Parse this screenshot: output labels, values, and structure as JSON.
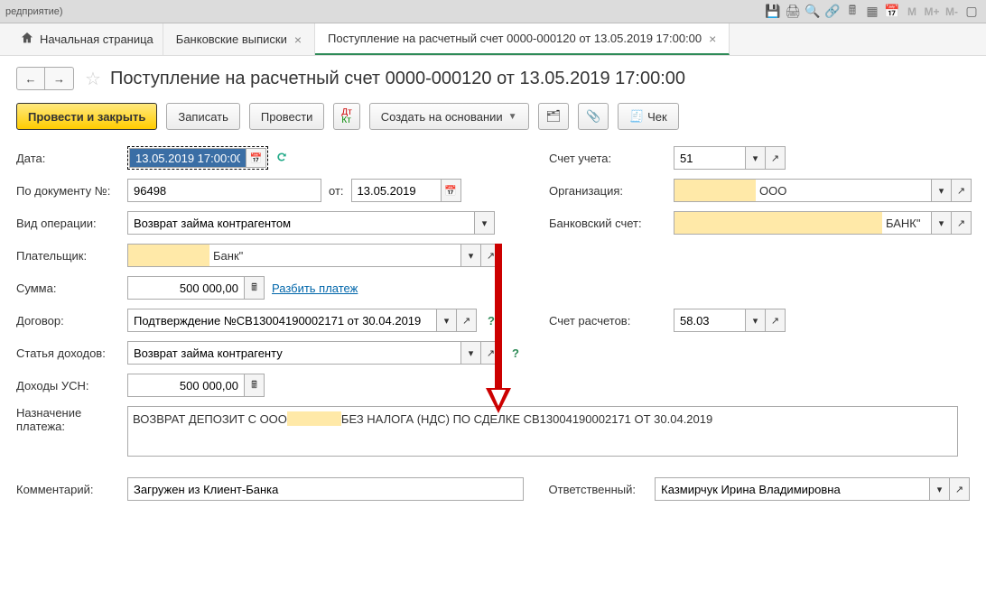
{
  "topbar": {
    "title": "редприятие)"
  },
  "topbar_icons": {
    "m": "M",
    "m_plus": "M+",
    "m_minus": "M-"
  },
  "tabs": {
    "home": "Начальная страница",
    "bank": "Банковские выписки",
    "current": "Поступление на расчетный счет 0000-000120 от 13.05.2019 17:00:00"
  },
  "page_title": "Поступление на расчетный счет 0000-000120 от 13.05.2019 17:00:00",
  "toolbar": {
    "post_close": "Провести и закрыть",
    "save": "Записать",
    "post": "Провести",
    "create_based": "Создать на основании",
    "check": "Чек"
  },
  "labels": {
    "date": "Дата:",
    "by_doc": "По документу №:",
    "from": "от:",
    "op_type": "Вид операции:",
    "payer": "Плательщик:",
    "amount": "Сумма:",
    "split": "Разбить платеж",
    "contract": "Договор:",
    "income_item": "Статья доходов:",
    "usn_income": "Доходы УСН:",
    "purpose": "Назначение платежа:",
    "comment": "Комментарий:",
    "account": "Счет учета:",
    "org": "Организация:",
    "bank_account": "Банковский счет:",
    "settle_account": "Счет расчетов:",
    "responsible": "Ответственный:"
  },
  "values": {
    "date": "13.05.2019 17:00:00",
    "doc_no": "96498",
    "doc_date": "13.05.2019",
    "op_type": "Возврат займа контрагентом",
    "payer": "Банк\"",
    "amount": "500 000,00",
    "contract": "Подтверждение №СВ13004190002171 от 30.04.2019",
    "income_item": "Возврат займа контрагенту",
    "usn_income": "500 000,00",
    "purpose_prefix": "ВОЗВРАТ ДЕПОЗИТ С ООО ",
    "purpose_suffix": " БЕЗ НАЛОГА (НДС) ПО СДЕЛКЕ СВ13004190002171 ОТ 30.04.2019",
    "comment": "Загружен из Клиент-Банка",
    "account": "51",
    "org": "ООО",
    "bank": "БАНК\"",
    "settle_account": "58.03",
    "responsible": "Казмирчук Ирина Владимировна"
  }
}
